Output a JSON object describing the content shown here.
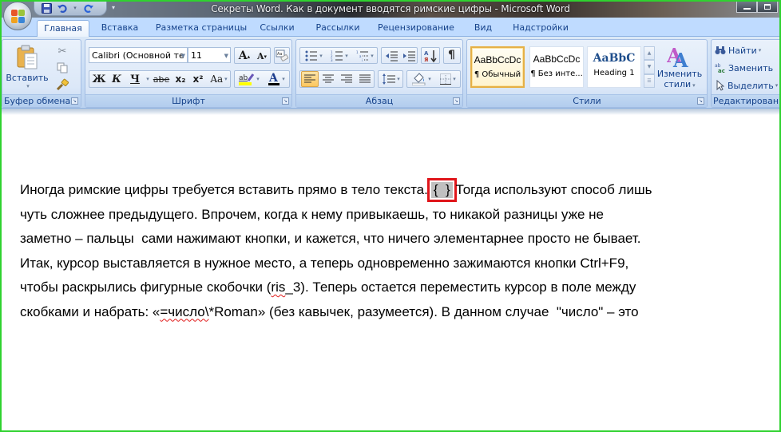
{
  "window": {
    "title": "Секреты Word. Как в документ вводятся римские цифры - Microsoft Word",
    "controls": [
      "minimize",
      "maximize"
    ]
  },
  "quick_access": {
    "items": [
      {
        "name": "save",
        "icon": "floppy-disk-icon"
      },
      {
        "name": "undo",
        "icon": "undo-arrow-icon"
      },
      {
        "name": "redo",
        "icon": "redo-arrow-icon"
      }
    ]
  },
  "tabs": [
    {
      "label": "Главная",
      "active": true
    },
    {
      "label": "Вставка"
    },
    {
      "label": "Разметка страницы"
    },
    {
      "label": "Ссылки"
    },
    {
      "label": "Рассылки"
    },
    {
      "label": "Рецензирование"
    },
    {
      "label": "Вид"
    },
    {
      "label": "Надстройки"
    }
  ],
  "ribbon": {
    "clipboard": {
      "label": "Буфер обмена",
      "paste_label": "Вставить"
    },
    "font": {
      "label": "Шрифт",
      "font_name": "Calibri (Основной те",
      "font_size": "11",
      "bold": "Ж",
      "italic": "К",
      "underline": "Ч",
      "strike": "abe",
      "subscript": "x₂",
      "superscript": "x²",
      "change_case": "Aa",
      "grow": "A",
      "shrink": "A",
      "highlight_color": "#ffff00",
      "font_color": "#000000"
    },
    "paragraph": {
      "label": "Абзац",
      "pilcrow": "¶",
      "active_align": "left"
    },
    "styles": {
      "label": "Стили",
      "items": [
        {
          "sample": "AaBbCcDc",
          "name": "¶ Обычный",
          "selected": true
        },
        {
          "sample": "AaBbCcDc",
          "name": "¶ Без инте..."
        },
        {
          "sample": "AaBbC",
          "name": "Heading 1"
        }
      ],
      "change_styles_line1": "Изменить",
      "change_styles_line2": "стили"
    },
    "editing": {
      "label": "Редактирование",
      "find": "Найти",
      "replace": "Заменить",
      "select": "Выделить"
    }
  },
  "document": {
    "lines": [
      {
        "before": "Иногда римские цифры требуется вставить прямо в тело текста.",
        "field": "{  }",
        "after": "Тогда используют способ лишь"
      },
      {
        "text": "чуть сложнее предыдущего. Впрочем, когда к нему привыкаешь, то никакой разницы уже не"
      },
      {
        "text": "заметно – пальцы  сами нажимают кнопки, и кажется, что ничего элементарнее просто не бывает."
      },
      {
        "text": "Итак, курсор выставляется в нужное место, а теперь одновременно зажимаются кнопки Ctrl+F9,"
      },
      {
        "before": "чтобы раскрылись фигурные скобочки (",
        "squiggle": "ris",
        "after": "_3). Теперь остается переместить курсор в поле между"
      },
      {
        "before": "скобками и набрать: «",
        "squiggle": "=число\\",
        "after": "*Roman» (без кавычек, разумеется). В данном случае  \"число\" – это"
      }
    ],
    "highlight_color": "#e0151a"
  }
}
